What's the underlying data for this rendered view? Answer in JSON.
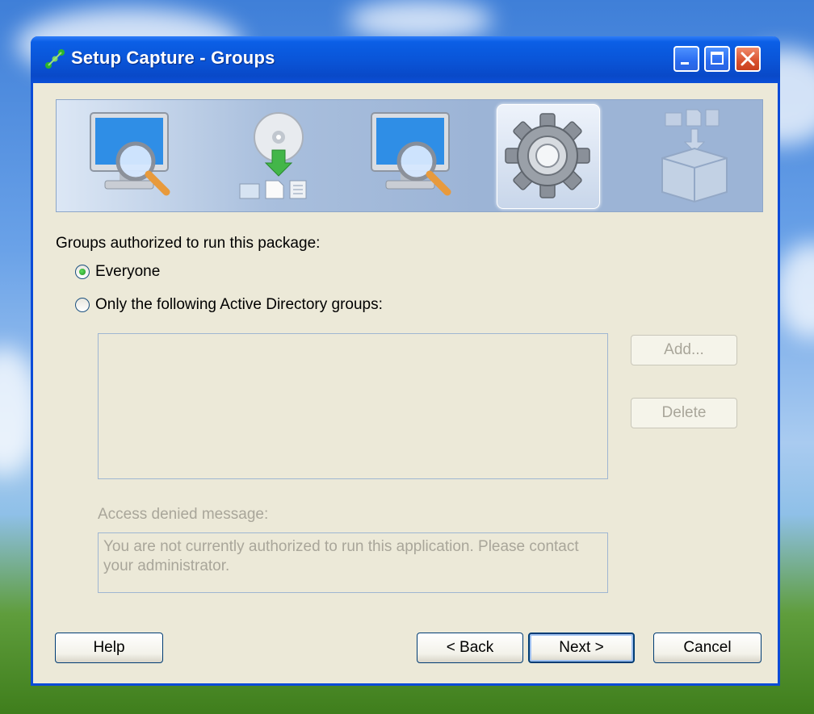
{
  "window": {
    "title": "Setup Capture - Groups",
    "buttons": [
      "minimize-icon",
      "maximize-icon",
      "close-icon"
    ]
  },
  "wizard_steps": [
    {
      "icon": "monitor-magnifier-icon",
      "state": "done"
    },
    {
      "icon": "disc-install-icon",
      "state": "done"
    },
    {
      "icon": "monitor-magnifier-icon",
      "state": "done"
    },
    {
      "icon": "gear-icon",
      "state": "active"
    },
    {
      "icon": "package-box-icon",
      "state": "pending"
    }
  ],
  "groups": {
    "heading": "Groups authorized to run this package:",
    "option_everyone": "Everyone",
    "option_ad_groups": "Only the following Active Directory groups:",
    "selected": "Everyone",
    "add_label": "Add...",
    "delete_label": "Delete"
  },
  "access": {
    "label": "Access denied message:",
    "message": "You are not currently authorized to run this application. Please contact your administrator."
  },
  "footer": {
    "help_label": "Help",
    "back_label": "< Back",
    "next_label": "Next >",
    "cancel_label": "Cancel"
  },
  "colors": {
    "titlebar": "#0a55d8",
    "window_bg": "#ece9d8",
    "disabled_text": "#a9a69a",
    "radio_selected": "#1c8e1c"
  }
}
